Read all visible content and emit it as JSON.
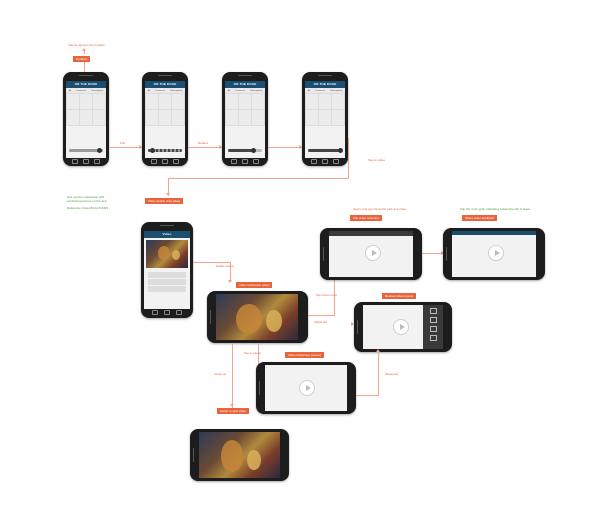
{
  "tags": {
    "duration": "Duration",
    "video_details": "Video details view (play)",
    "video_landscape_play": "Video landscape (play)",
    "clip_video_selection": "Clip video selection",
    "share_video_feedback": "Share video feedback",
    "related_videos_panel": "Related videos panel",
    "video_landscape_pause": "Video landscape (pause)",
    "swipe_to_next_video": "Swipe to next video"
  },
  "notes": {
    "volume_ignore": "Volume ignores the timeline",
    "full": "Full",
    "reduce": "Reduce",
    "tap_on_video": "Tap on video",
    "rotate_phone": "Rotate phone",
    "tap_screen_icon": "Tap screen icon",
    "swipe_left": "Swipe left",
    "tap_to_pause": "Tap to pause",
    "swipe_up": "Swipe up",
    "swipe_left_2": "Swipe left",
    "clip_top": "Users only your favourite part of a video",
    "clip_clip_top": "Clip the 'cute' grab, indicating subset the clip is tweet"
  },
  "green_notes": {
    "interaction_line_1": "Use cursive: interaction with",
    "interaction_line_2": "control/experience on the app",
    "reference": "Reference: https://bit.ly/1hKj9S"
  },
  "phones": {
    "app_title": "ON THE EDGE",
    "tab_labels": [
      "All",
      "Comments",
      "Subscriptions"
    ],
    "details_title": "Video"
  },
  "colors": {
    "accent": "#e8643c",
    "connector": "#f0a58c",
    "note_green": "#4a9a3a",
    "appbar": "#1b4f72",
    "phone_body": "#1d1d1d"
  }
}
